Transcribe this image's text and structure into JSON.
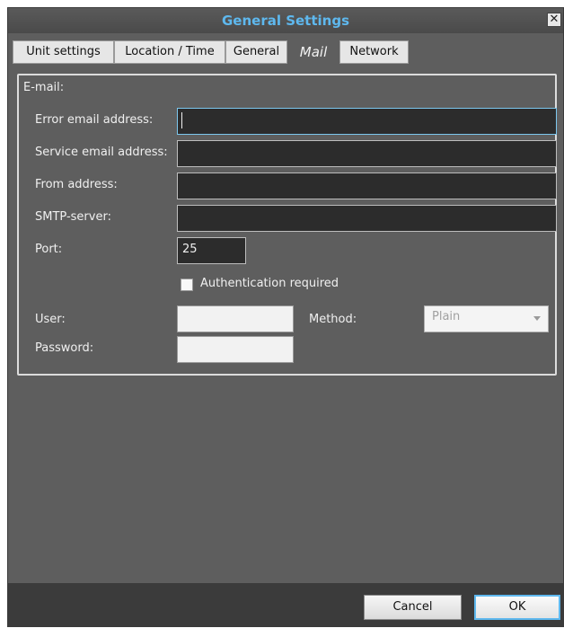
{
  "window": {
    "title": "General Settings",
    "close_glyph": "✕"
  },
  "tabs": [
    {
      "label": "Unit settings"
    },
    {
      "label": "Location / Time"
    },
    {
      "label": "General"
    },
    {
      "label": "Mail",
      "active": true
    },
    {
      "label": "Network"
    }
  ],
  "email": {
    "group_label": "E-mail:",
    "error_label": "Error email address:",
    "error_value": "",
    "service_label": "Service email address:",
    "service_value": "",
    "from_label": "From address:",
    "from_value": "",
    "smtp_label": "SMTP-server:",
    "smtp_value": "",
    "port_label": "Port:",
    "port_value": "25",
    "auth_label": "Authentication required",
    "auth_checked": false,
    "user_label": "User:",
    "user_value": "",
    "password_label": "Password:",
    "password_value": "",
    "method_label": "Method:",
    "method_value": "Plain"
  },
  "footer": {
    "cancel_label": "Cancel",
    "ok_label": "OK"
  },
  "colors": {
    "title": "#5eb8ee",
    "background": "#5e5e5e",
    "accent": "#5eb8ee"
  }
}
